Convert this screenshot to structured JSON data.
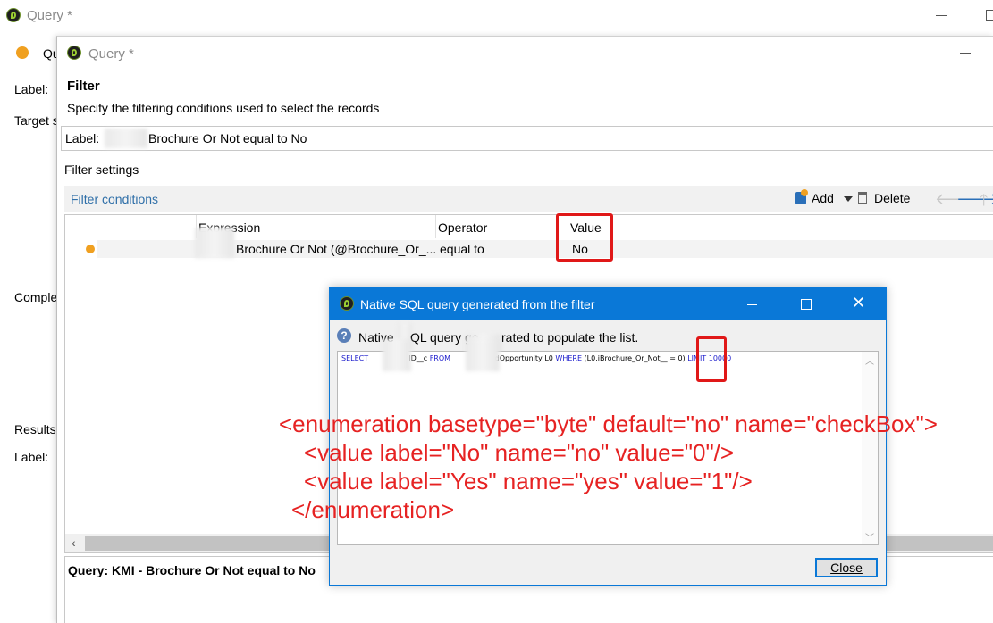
{
  "outer_window": {
    "title": "Query *",
    "side_labels": {
      "label1": "Label:",
      "target": "Target s",
      "comple": "Comple",
      "results": "Results",
      "label2": "Label:",
      "qu": "Qu"
    }
  },
  "inner_window": {
    "title": "Query *",
    "section_title": "Filter",
    "description": "Specify the filtering conditions used to select the records",
    "label_prefix": "Label:",
    "label_value": "Brochure Or Not equal to No",
    "filter_settings": "Filter settings",
    "filter_conditions": "Filter conditions",
    "toolbar": {
      "add": "Add",
      "delete": "Delete"
    },
    "table": {
      "columns": [
        "Expression",
        "Operator",
        "Value"
      ],
      "rows": [
        {
          "expression": "Brochure Or Not (@Brochure_Or_...",
          "operator": "equal to",
          "value": "No"
        }
      ]
    },
    "query_footer": "Query: KMI - Brochure Or Not equal to No"
  },
  "dialog": {
    "title": "Native SQL query generated from the filter",
    "info_part1": "Native",
    "info_part2": "QL query ge",
    "info_part3": "rated to populate the list.",
    "sql": {
      "select": "SELECT",
      "col": "ID__c",
      "from": "FROM",
      "table": "AndOpportunity L0",
      "where": "WHERE",
      "cond": "(L0.iBrochure_Or_Not__",
      "cond_end": "= 0)",
      "limit_kw": "LIMIT",
      "limit_val": "10000"
    },
    "annotation_lines": [
      "<enumeration basetype=\"byte\" default=\"no\" name=\"checkBox\">",
      "<value label=\"No\" name=\"no\" value=\"0\"/>",
      "<value label=\"Yes\" name=\"yes\" value=\"1\"/>",
      "</enumeration>"
    ],
    "close_label": "Close",
    "colors": {
      "title_bar": "#0a78d7",
      "annotation": "#e62222",
      "highlight": "#e01818"
    }
  }
}
